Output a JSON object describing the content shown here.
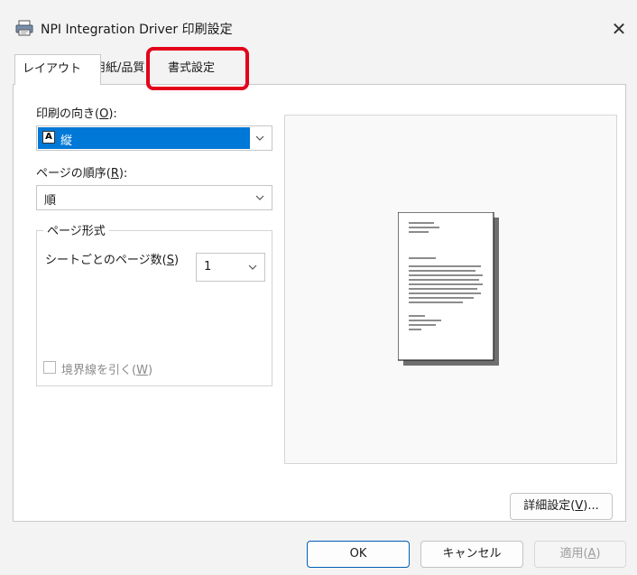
{
  "window": {
    "title": "NPI Integration Driver 印刷設定",
    "close_glyph": "✕"
  },
  "tabs": [
    {
      "label": "レイアウト",
      "selected": true
    },
    {
      "label": "用紙/品質",
      "selected": false
    },
    {
      "label": "書式設定",
      "selected": false,
      "highlighted": true
    }
  ],
  "highlight_color": "#e3001b",
  "orientation": {
    "label_prefix": "印刷の向き(",
    "label_key": "O",
    "label_suffix": "):",
    "value": "縦",
    "icon": "portrait-page-icon"
  },
  "page_order": {
    "label_prefix": "ページの順序(",
    "label_key": "R",
    "label_suffix": "):",
    "value": "順"
  },
  "page_format": {
    "group_title": "ページ形式",
    "pages_per_sheet_prefix": "シートごとのページ数(",
    "pages_per_sheet_key": "S",
    "pages_per_sheet_suffix": ")",
    "pages_per_sheet_value": "1",
    "border_prefix": "境界線を引く(",
    "border_key": "W",
    "border_suffix": ")",
    "border_checked": false,
    "border_enabled": false
  },
  "buttons": {
    "details_prefix": "詳細設定(",
    "details_key": "V",
    "details_suffix": ")...",
    "ok": "OK",
    "cancel": "キャンセル",
    "apply_prefix": "適用(",
    "apply_key": "A",
    "apply_suffix": ")"
  },
  "accent_color": "#0078d7"
}
